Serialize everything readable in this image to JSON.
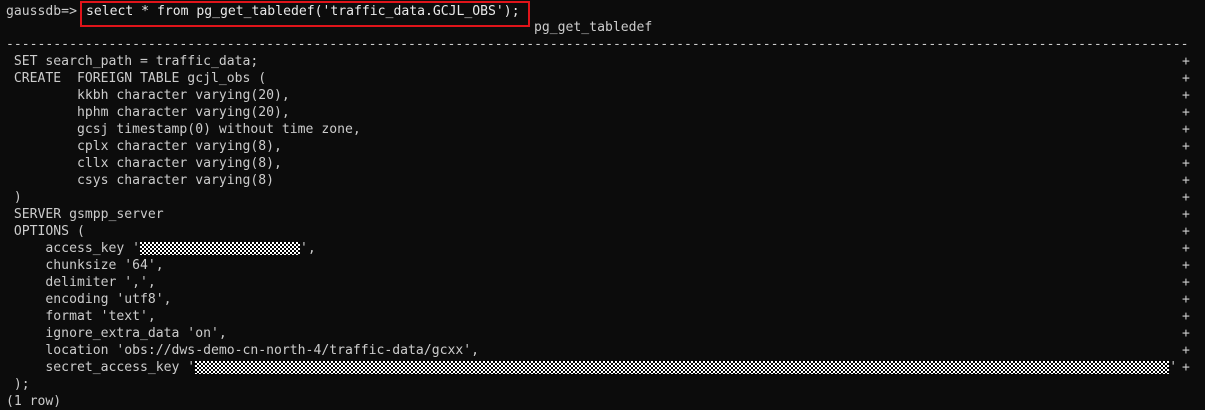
{
  "prompt": "gaussdb=>",
  "command": "select * from pg_get_tabledef('traffic_data.GCJL_OBS');",
  "column_header": "pg_get_tabledef",
  "separator_char": "-",
  "continuation_mark": "+",
  "rows": [
    {
      "pre": " SET search_path = traffic_data;",
      "post": ""
    },
    {
      "pre": " CREATE  FOREIGN TABLE gcjl_obs (",
      "post": ""
    },
    {
      "pre": "         kkbh character varying(20),",
      "post": ""
    },
    {
      "pre": "         hphm character varying(20),",
      "post": ""
    },
    {
      "pre": "         gcsj timestamp(0) without time zone,",
      "post": ""
    },
    {
      "pre": "         cplx character varying(8),",
      "post": ""
    },
    {
      "pre": "         cllx character varying(8),",
      "post": ""
    },
    {
      "pre": "         csys character varying(8)",
      "post": ""
    },
    {
      "pre": " )",
      "post": ""
    },
    {
      "pre": " SERVER gsmpp_server",
      "post": ""
    },
    {
      "pre": " OPTIONS (",
      "post": ""
    },
    {
      "pre": "     access_key '",
      "post": "',",
      "masked": true,
      "mask_kind": "short"
    },
    {
      "pre": "     chunksize '64',",
      "post": ""
    },
    {
      "pre": "     delimiter ',',",
      "post": ""
    },
    {
      "pre": "     encoding 'utf8',",
      "post": ""
    },
    {
      "pre": "     format 'text',",
      "post": ""
    },
    {
      "pre": "     ignore_extra_data 'on',",
      "post": ""
    },
    {
      "pre": "     location 'obs://dws-demo-cn-north-4/traffic-data/gcxx',",
      "post": ""
    },
    {
      "pre": "     secret_access_key '",
      "post": "'",
      "masked": true,
      "mask_kind": "long"
    },
    {
      "pre": " );",
      "post": "",
      "no_plus": true
    }
  ],
  "row_count": "(1 row)",
  "colors": {
    "background": "#0c0c0c",
    "text": "#cccccc",
    "highlight_border": "#e0141a"
  }
}
